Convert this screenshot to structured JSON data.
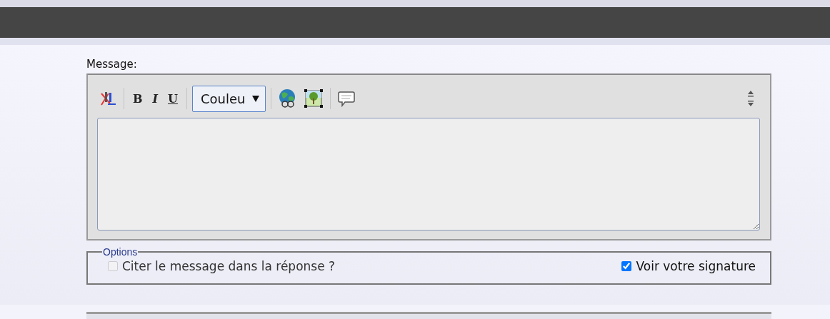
{
  "message_label": "Message:",
  "toolbar": [
    {
      "kind": "clearformat"
    },
    {
      "kind": "sep"
    },
    {
      "kind": "bold",
      "label": "B"
    },
    {
      "kind": "italic",
      "label": "I"
    },
    {
      "kind": "underline",
      "label": "U"
    },
    {
      "kind": "sep"
    },
    {
      "kind": "select",
      "value": "Couleu"
    },
    {
      "kind": "sep"
    },
    {
      "kind": "globe"
    },
    {
      "kind": "image"
    },
    {
      "kind": "sep"
    },
    {
      "kind": "comment"
    }
  ],
  "options": {
    "legend": "Options",
    "items": [
      {
        "label": "Citer le message dans la réponse ?",
        "checked": false,
        "disabled": true
      },
      {
        "label": "Voir votre signature",
        "checked": true,
        "disabled": false
      }
    ]
  }
}
